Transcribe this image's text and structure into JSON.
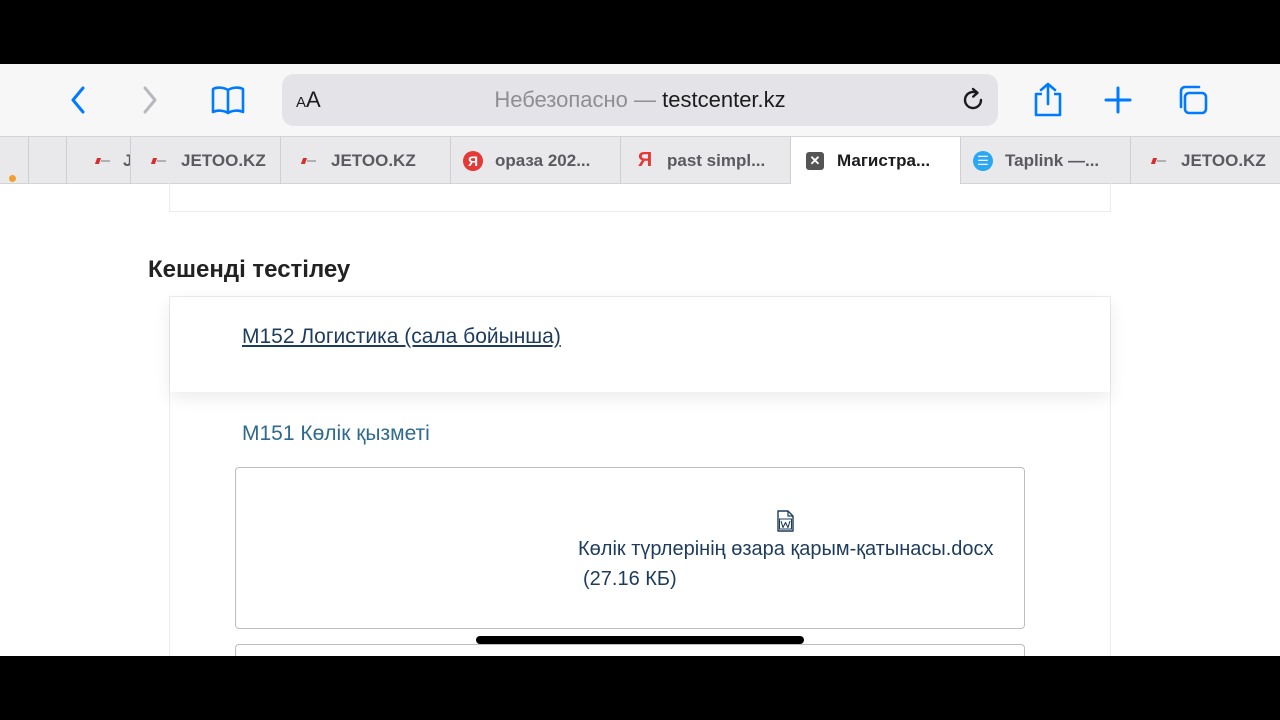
{
  "toolbar": {
    "address": {
      "prefix": "Небезопасно — ",
      "host": "testcenter.kz",
      "text_size_label": "AA"
    }
  },
  "tabs": [
    {
      "label": "J",
      "icon": "jetoo-icon",
      "active": false
    },
    {
      "label": "JETOO.KZ",
      "icon": "jetoo-icon",
      "active": false
    },
    {
      "label": "JETOO.KZ",
      "icon": "jetoo-icon",
      "active": false
    },
    {
      "label": "ораза 202...",
      "icon": "yandex-icon",
      "active": false
    },
    {
      "label": "past simpl...",
      "icon": "yandex-icon",
      "active": false
    },
    {
      "label": "Магистра...",
      "icon": "close-tab-icon",
      "active": true
    },
    {
      "label": "Taplink —...",
      "icon": "taplink-icon",
      "active": false
    },
    {
      "label": "JETOO.KZ",
      "icon": "jetoo-icon",
      "active": false
    }
  ],
  "page": {
    "section_title": "Кешенді тестілеу",
    "link_logistics": "M152 Логистика (сала бойынша)",
    "link_transport": "M151 Көлік қызметі",
    "file": {
      "name": "Көлік түрлерінің өзара қарым-қатынасы.docx",
      "size": "(27.16 КБ)",
      "icon": "word-doc-icon"
    }
  },
  "colors": {
    "link": "#1d3c5c",
    "accent": "#2e6a8e",
    "safari_blue": "#007aff"
  }
}
